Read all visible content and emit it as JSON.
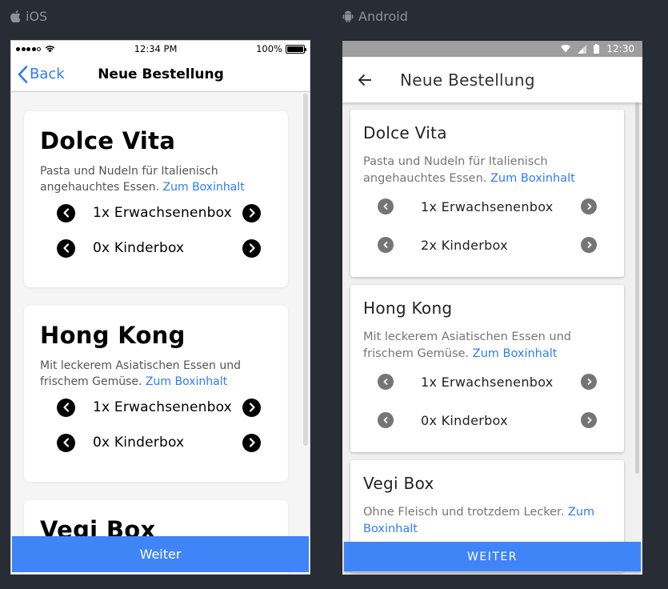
{
  "labels": {
    "ios": "iOS",
    "android": "Android"
  },
  "ios": {
    "status": {
      "time": "12:34 PM",
      "battery": "100%"
    },
    "nav": {
      "back_label": "Back",
      "title": "Neue Bestellung"
    },
    "cards": [
      {
        "title": "Dolce Vita",
        "description": "Pasta und Nudeln für Italienisch angehauchtes Essen. ",
        "link": "Zum Boxinhalt",
        "adult": "1x Erwachsenenbox",
        "kids": "0x Kinderbox"
      },
      {
        "title": "Hong Kong",
        "description": "Mit leckerem Asiatischen Essen und frischem Gemüse. ",
        "link": "Zum Boxinhalt",
        "adult": "1x Erwachsenenbox",
        "kids": "0x Kinderbox"
      },
      {
        "title": "Vegi Box"
      }
    ],
    "button_label": "Weiter"
  },
  "android": {
    "status": {
      "time": "12:30"
    },
    "appbar": {
      "title": "Neue Bestellung"
    },
    "cards": [
      {
        "title": "Dolce Vita",
        "description": "Pasta und Nudeln für Italienisch angehauchtes Essen. ",
        "link": "Zum Boxinhalt",
        "adult": "1x Erwachsenenbox",
        "kids": "2x Kinderbox"
      },
      {
        "title": "Hong Kong",
        "description": "Mit leckerem Asiatischen Essen und frischem Gemüse. ",
        "link": "Zum Boxinhalt",
        "adult": "1x Erwachsenenbox",
        "kids": "0x Kinderbox"
      },
      {
        "title": "Vegi Box",
        "description": "Ohne Fleisch und trotzdem Lecker. ",
        "link": "Zum Boxinhalt"
      }
    ],
    "button_label": "WEITER"
  },
  "colors": {
    "accent": "#3f85f7",
    "link": "#2e7cf6",
    "background": "#272c35"
  }
}
